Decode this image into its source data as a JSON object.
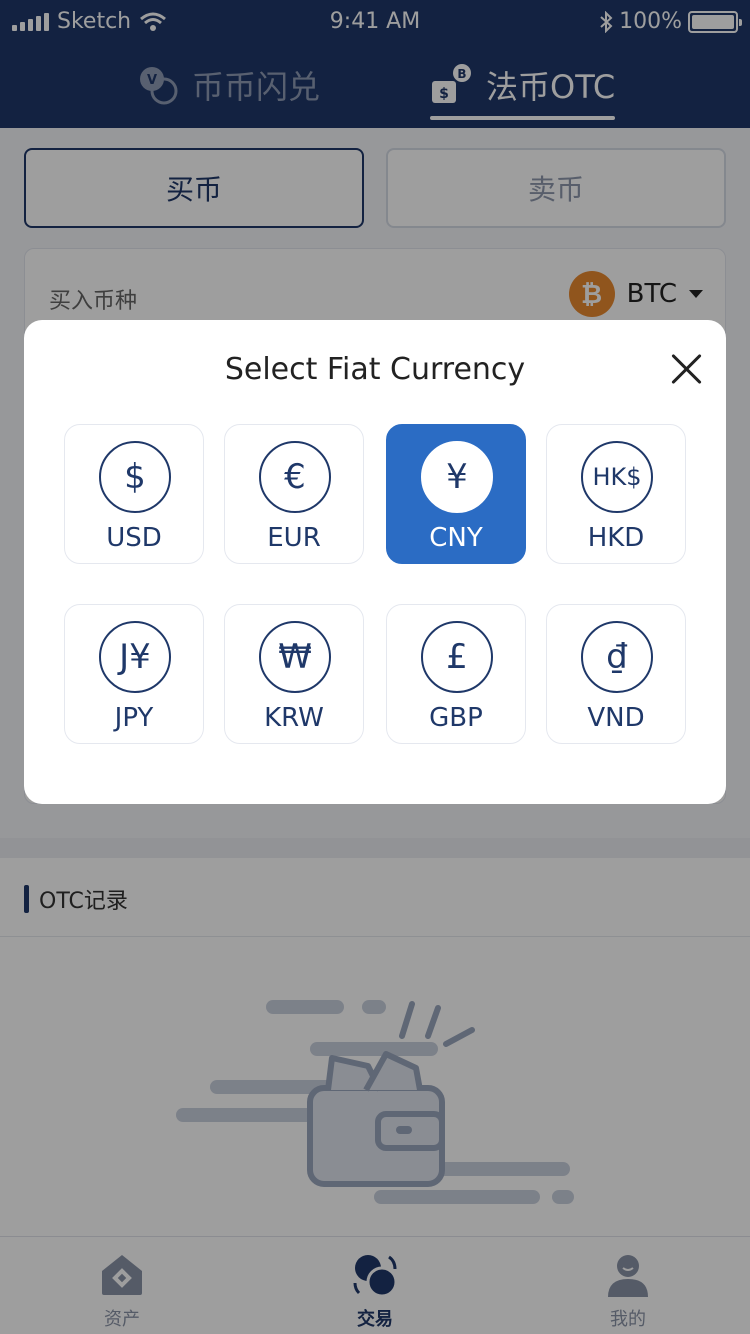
{
  "status_bar": {
    "carrier": "Sketch",
    "time": "9:41 AM",
    "battery": "100%"
  },
  "header": {
    "tabs": [
      {
        "label": "币币闪兑",
        "active": false,
        "icon": "coin-swap-icon"
      },
      {
        "label": "法币OTC",
        "active": true,
        "icon": "fiat-otc-icon"
      }
    ]
  },
  "trade": {
    "buy_label": "买币",
    "sell_label": "卖币",
    "buy_coin_label": "买入币种",
    "coin": "BTC"
  },
  "records": {
    "title": "OTC记录"
  },
  "bottom_nav": [
    {
      "label": "资产",
      "icon": "assets-icon"
    },
    {
      "label": "交易",
      "icon": "trade-icon",
      "active": true
    },
    {
      "label": "我的",
      "icon": "profile-icon"
    }
  ],
  "modal": {
    "title": "Select Fiat Currency",
    "selected": "CNY",
    "currencies": [
      {
        "symbol": "$",
        "code": "USD"
      },
      {
        "symbol": "€",
        "code": "EUR"
      },
      {
        "symbol": "¥",
        "code": "CNY"
      },
      {
        "symbol": "HK$",
        "code": "HKD"
      },
      {
        "symbol": "J¥",
        "code": "JPY"
      },
      {
        "symbol": "₩",
        "code": "KRW"
      },
      {
        "symbol": "£",
        "code": "GBP"
      },
      {
        "symbol": "₫",
        "code": "VND"
      }
    ]
  },
  "colors": {
    "brand_navy": "#1f3869",
    "selected_blue": "#2b6cc4",
    "btc_orange": "#e9892f"
  }
}
